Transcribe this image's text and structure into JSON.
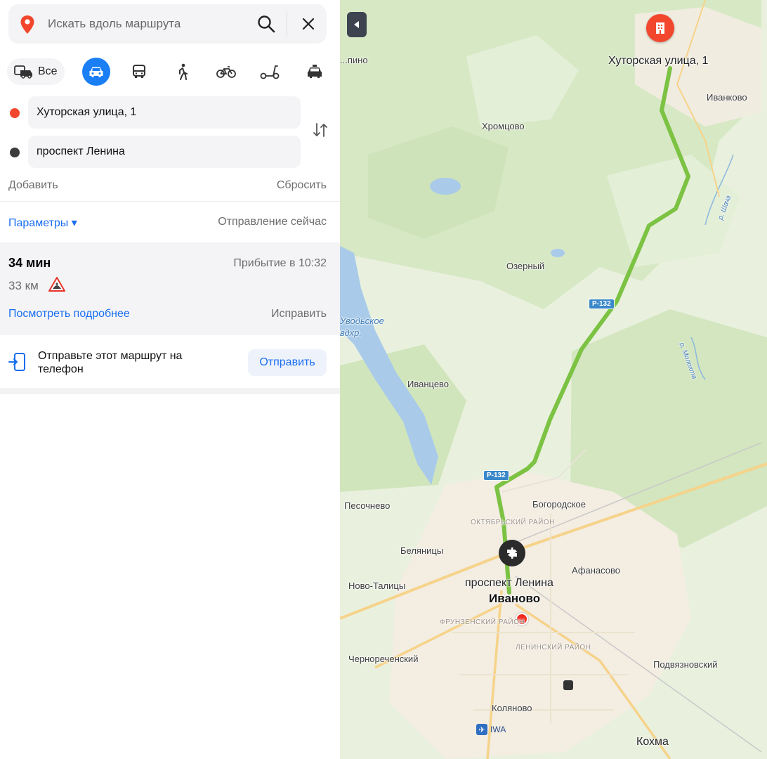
{
  "search": {
    "placeholder": "Искать вдоль маршрута"
  },
  "transport": {
    "all_label": "Все",
    "modes": [
      "car",
      "bus",
      "walk",
      "bicycle",
      "scooter",
      "taxi"
    ],
    "active": "car"
  },
  "route": {
    "from": "Хуторская улица, 1",
    "to": "проспект Ленина",
    "add_label": "Добавить",
    "reset_label": "Сбросить"
  },
  "params": {
    "label": "Параметры ▾",
    "departure": "Отправление сейчас"
  },
  "result": {
    "duration": "34 мин",
    "arrival": "Прибытие в 10:32",
    "distance": "33 км",
    "details_label": "Посмотреть подробнее",
    "fix_label": "Исправить"
  },
  "send": {
    "text": "Отправьте этот маршрут на телефон",
    "button": "Отправить"
  },
  "colors": {
    "accent": "#1a7ff5",
    "start": "#f2472d",
    "route": "#7cc243"
  },
  "map": {
    "labels": {
      "ilyinskoe": "...пино",
      "start_address": "Хуторская улица, 1",
      "ivankovo": "Иванково",
      "khromtsovo": "Хромцово",
      "shacha": "р. Шача",
      "ozerny": "Озерный",
      "road1": "Р-132",
      "uvod": "Уводьское вдхр.",
      "molokhta": "р. Молохта",
      "ivantsevo": "Иванцево",
      "road2": "Р-132",
      "pesochnevo": "Песочнево",
      "bogorodskoe": "Богородское",
      "oktyabrsky": "ОКТЯБРЬСКИЙ РАЙОН",
      "belyanitsy": "Беляницы",
      "afanasovo": "Афанасово",
      "novo_talitsy": "Ново-Талицы",
      "end_address": "проспект Ленина",
      "ivanovo": "Иваново",
      "frunzensky": "ФРУНЗЕНСКИЙ РАЙОН",
      "leninsky": "ЛЕНИНСКИЙ РАЙОН",
      "chernorechensky": "Чернореченский",
      "podvyaznovsky": "Подвязновский",
      "kolyanovo": "Коляново",
      "airport": "IWA",
      "kokhma": "Кохма"
    }
  }
}
